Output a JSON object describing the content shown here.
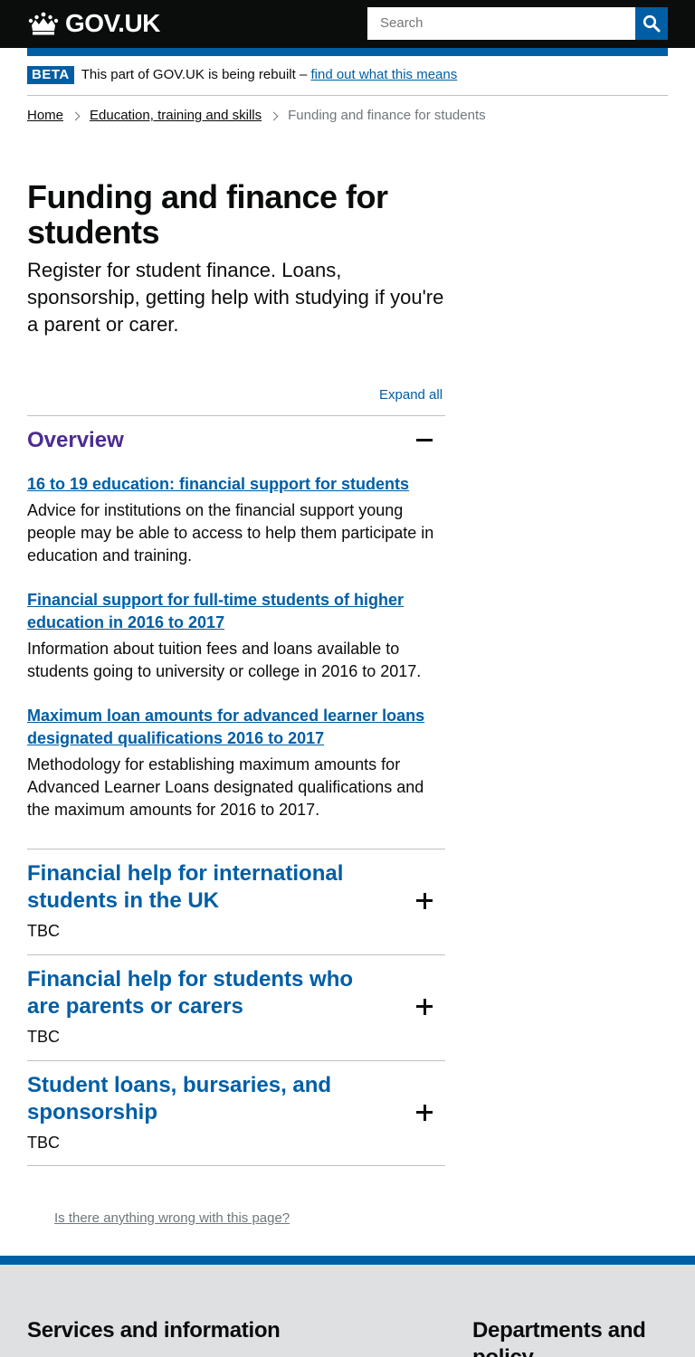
{
  "header": {
    "logo_text": "GOV.UK",
    "search_placeholder": "Search",
    "search_button_label": "Search"
  },
  "beta_banner": {
    "tag": "BETA",
    "text": "This part of GOV.UK is being rebuilt –",
    "link": "find out what this means"
  },
  "breadcrumb": {
    "items": [
      "Home",
      "Education, training and skills"
    ],
    "current": "Funding and finance for students"
  },
  "page": {
    "title": "Funding and finance for students",
    "lede": "Register for student finance. Loans, sponsorship, getting help with studying if you're a parent or carer."
  },
  "accordion": {
    "expand_all": "Expand all",
    "sections": [
      {
        "title": "Overview",
        "state": "open",
        "items": [
          {
            "link": "16 to 19 education: financial support for students",
            "desc": "Advice for institutions on the financial support young people may be able to access to help them participate in education and training."
          },
          {
            "link": "Financial support for full-time students of higher education in 2016 to 2017",
            "desc": "Information about tuition fees and loans available to students going to university or college in 2016 to 2017."
          },
          {
            "link": "Maximum loan amounts for advanced learner loans designated qualifications 2016 to 2017",
            "desc": "Methodology for establishing maximum amounts for Advanced Learner Loans designated qualifications and the maximum amounts for 2016 to 2017."
          }
        ]
      },
      {
        "title": "Financial help for international students in the UK",
        "state": "closed",
        "summary": "TBC"
      },
      {
        "title": "Financial help for students who are parents or carers",
        "state": "closed",
        "summary": "TBC"
      },
      {
        "title": "Student loans, bursaries, and sponsorship",
        "state": "closed",
        "summary": "TBC"
      }
    ]
  },
  "report_link": "Is there anything wrong with this page?",
  "footer": {
    "heading_1": "Services and information",
    "heading_2": "Departments and policy"
  },
  "colors": {
    "link": "#005ea5",
    "visited": "#4c2c92",
    "header": "#0b0c0c",
    "footer": "#dee0e2"
  },
  "icons": [
    "crown-icon",
    "search-icon",
    "chevron-right-icon",
    "minus-icon",
    "plus-icon"
  ]
}
